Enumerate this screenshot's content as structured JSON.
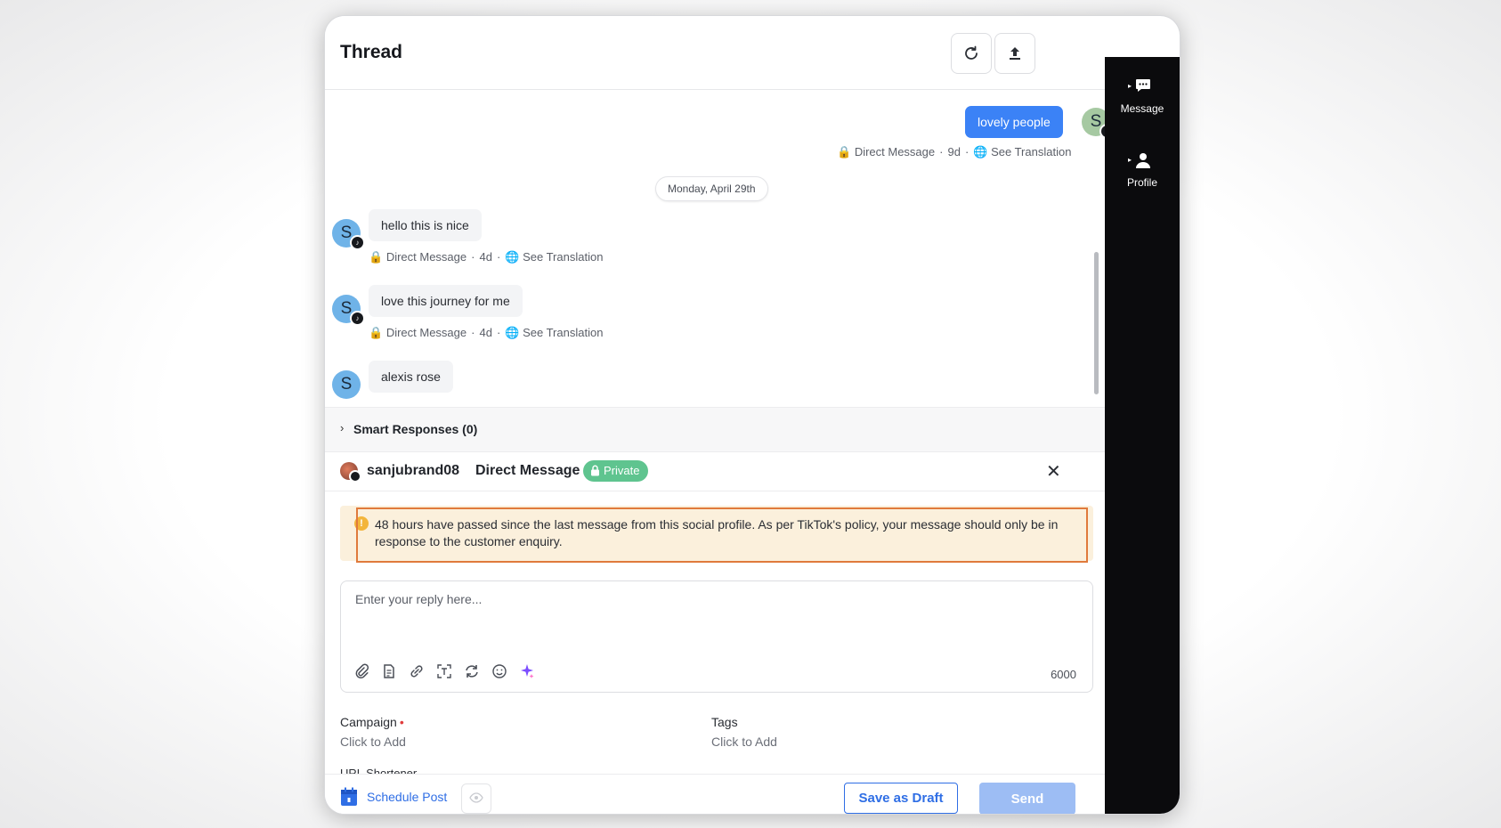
{
  "header": {
    "title": "Thread",
    "refresh_icon": "refresh-icon",
    "export_icon": "upload-icon"
  },
  "sidebar": {
    "items": [
      {
        "label": "Message",
        "icon": "chat-bubble-icon"
      },
      {
        "label": "Profile",
        "icon": "person-icon"
      }
    ]
  },
  "thread": {
    "outgoing": {
      "text": "lovely people",
      "avatar_letter": "S",
      "meta": {
        "channel": "Direct Message",
        "age": "9d",
        "translate": "See Translation"
      }
    },
    "date_separator": "Monday, April 29th",
    "messages": [
      {
        "text": "hello this is nice",
        "avatar_letter": "S",
        "meta": {
          "channel": "Direct Message",
          "age": "4d",
          "translate": "See Translation"
        }
      },
      {
        "text": "love this journey for me",
        "avatar_letter": "S",
        "meta": {
          "channel": "Direct Message",
          "age": "4d",
          "translate": "See Translation"
        }
      },
      {
        "text": "alexis rose",
        "avatar_letter": "S"
      }
    ]
  },
  "smart_responses": {
    "label": "Smart Responses (0)"
  },
  "composer": {
    "username": "sanjubrand08",
    "channel": "Direct Message",
    "privacy": "Private",
    "warning": "48 hours have passed since the last message from this social profile. As per TikTok's policy, your message should only be in response to the customer enquiry.",
    "reply_placeholder": "Enter your reply here...",
    "char_counter": "6000",
    "toolbar_icons": [
      "attachment-icon",
      "document-icon",
      "link-icon",
      "text-scan-icon",
      "repost-icon",
      "emoji-icon",
      "ai-sparkle-icon"
    ]
  },
  "fields": {
    "campaign": {
      "label": "Campaign",
      "value": "Click to Add",
      "required_mark": "•"
    },
    "tags": {
      "label": "Tags",
      "value": "Click to Add"
    },
    "url_shortener": {
      "label": "URL Shortener"
    }
  },
  "footer": {
    "schedule_label": "Schedule Post",
    "draft_label": "Save as Draft",
    "send_label": "Send"
  },
  "colors": {
    "accent": "#3b82f6",
    "primary_link": "#2f6ee5",
    "private_badge": "#5fc48f",
    "warning_bg": "#fbf0dc",
    "highlight_outline": "#e07a3c",
    "rail_bg": "#0b0b0d"
  }
}
